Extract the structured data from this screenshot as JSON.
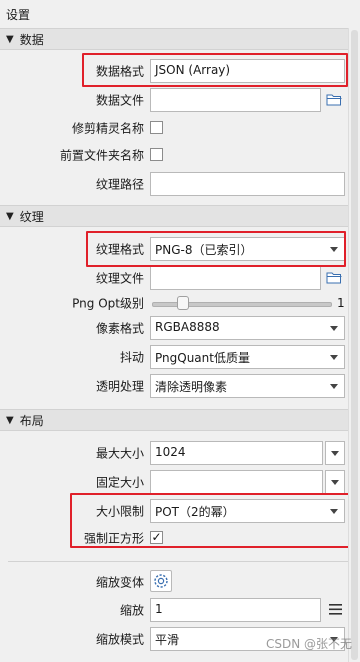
{
  "window": {
    "title": "设置"
  },
  "sections": {
    "data": {
      "header": "数据",
      "data_format_label": "数据格式",
      "data_format_value": "JSON (Array)",
      "data_file_label": "数据文件",
      "data_file_value": "",
      "trim_sprite_names_label": "修剪精灵名称",
      "prepend_folder_name_label": "前置文件夹名称",
      "texture_path_label": "纹理路径",
      "texture_path_value": ""
    },
    "texture": {
      "header": "纹理",
      "texture_format_label": "纹理格式",
      "texture_format_value": "PNG-8（已索引）",
      "texture_file_label": "纹理文件",
      "texture_file_value": "",
      "png_opt_label": "Png Opt级别",
      "png_opt_value": "1",
      "pixel_format_label": "像素格式",
      "pixel_format_value": "RGBA8888",
      "dithering_label": "抖动",
      "dithering_value": "PngQuant低质量",
      "transparency_label": "透明处理",
      "transparency_value": "清除透明像素"
    },
    "layout": {
      "header": "布局",
      "max_size_label": "最大大小",
      "max_size_value": "1024",
      "fixed_size_label": "固定大小",
      "fixed_size_value": "",
      "size_constraint_label": "大小限制",
      "size_constraint_value": "POT（2的幂）",
      "force_squared_label": "强制正方形",
      "force_squared_check": "✓",
      "scale_variants_label": "缩放变体",
      "scale_label": "缩放",
      "scale_value": "1",
      "scale_mode_label": "缩放模式",
      "scale_mode_value": "平滑"
    }
  },
  "checkboxes": {
    "trim_sprite_names": false,
    "prepend_folder_name": false,
    "force_squared": true
  },
  "slider": {
    "png_opt_level_fraction": 0.15
  },
  "watermark": "CSDN @张不无",
  "colors": {
    "highlight": "#e0202a",
    "header_bg": "#e3e3e3",
    "panel_bg": "#f0f0f0"
  },
  "icons": {
    "folder": "folder-open-icon",
    "gear": "gear-icon",
    "menu": "menu-icon",
    "triangle": "triangle-down-icon"
  }
}
